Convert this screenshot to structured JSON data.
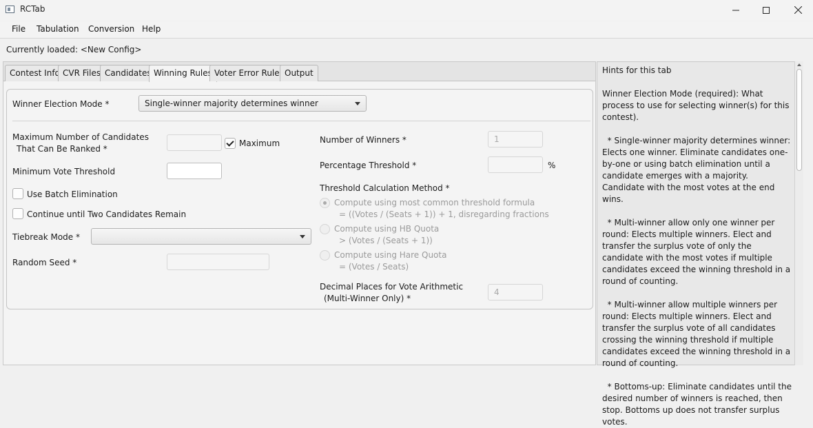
{
  "window": {
    "title": "RCTab"
  },
  "menu": [
    "File",
    "Tabulation",
    "Conversion",
    "Help"
  ],
  "status": {
    "loaded": "Currently loaded: <New Config>"
  },
  "tabs": [
    "Contest Info",
    "CVR Files",
    "Candidates",
    "Winning Rules",
    "Voter Error Rules",
    "Output"
  ],
  "active_tab": "Winning Rules",
  "form": {
    "winner_mode_label": "Winner Election Mode *",
    "winner_mode_value": "Single-winner majority determines winner",
    "max_cands_label_1": "Maximum Number of Candidates",
    "max_cands_label_2": "That Can Be Ranked *",
    "max_cands_value": "",
    "maximum_checkbox_label": "Maximum",
    "maximum_checked": true,
    "min_vote_label": "Minimum Vote Threshold",
    "min_vote_value": "",
    "batch_label": "Use Batch Elimination",
    "continue_label": "Continue until Two Candidates Remain",
    "tiebreak_label": "Tiebreak Mode *",
    "tiebreak_value": "",
    "seed_label": "Random Seed *",
    "seed_value": "",
    "num_winners_label": "Number of Winners *",
    "num_winners_value": "1",
    "pct_threshold_label": "Percentage Threshold *",
    "pct_threshold_value": "",
    "pct_unit": "%",
    "threshold_method_label": "Threshold Calculation Method *",
    "threshold_options": [
      {
        "line1": "Compute using most common threshold formula",
        "line2": "= ((Votes / (Seats + 1)) + 1, disregarding fractions",
        "selected": true
      },
      {
        "line1": "Compute using HB Quota",
        "line2": "> (Votes / (Seats + 1))",
        "selected": false
      },
      {
        "line1": "Compute using Hare Quota",
        "line2": "= (Votes / Seats)",
        "selected": false
      }
    ],
    "decimal_label_1": "Decimal Places for Vote Arithmetic",
    "decimal_label_2": "(Multi-Winner Only) *",
    "decimal_value": "4"
  },
  "hints": {
    "text": "Hints for this tab\n\nWinner Election Mode (required): What process to use for selecting winner(s) for this contest).\n\n  * Single-winner majority determines winner: Elects one winner. Eliminate candidates one-by-one or using batch elimination until a candidate emerges with a majority. Candidate with the most votes at the end wins.\n\n  * Multi-winner allow only one winner per round: Elects multiple winners. Elect and transfer the surplus vote of only the candidate with the most votes if multiple candidates exceed the winning threshold in a round of counting.\n\n  * Multi-winner allow multiple winners per round: Elects multiple winners. Elect and transfer the surplus vote of all candidates crossing the winning threshold if multiple candidates exceed the winning threshold in a round of counting.\n\n  * Bottoms-up: Eliminate candidates until the desired number of winners is reached, then stop. Bottoms up does not transfer surplus votes."
  }
}
